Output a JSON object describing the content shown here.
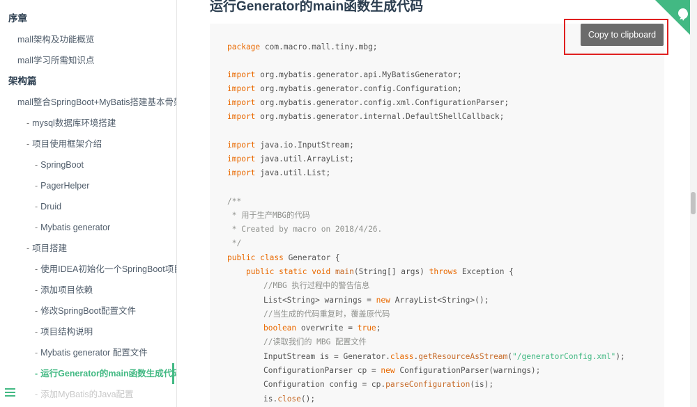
{
  "sidebar": {
    "items": [
      {
        "label": "序章",
        "level": "section"
      },
      {
        "label": "mall架构及功能概览",
        "level": "l1"
      },
      {
        "label": "mall学习所需知识点",
        "level": "l1"
      },
      {
        "label": "架构篇",
        "level": "section"
      },
      {
        "label": "mall整合SpringBoot+MyBatis搭建基本骨架",
        "level": "l1"
      },
      {
        "label": "mysql数据库环境搭建",
        "level": "l2"
      },
      {
        "label": "项目使用框架介绍",
        "level": "l2"
      },
      {
        "label": "SpringBoot",
        "level": "l3"
      },
      {
        "label": "PagerHelper",
        "level": "l3"
      },
      {
        "label": "Druid",
        "level": "l3"
      },
      {
        "label": "Mybatis generator",
        "level": "l3"
      },
      {
        "label": "项目搭建",
        "level": "l2"
      },
      {
        "label": "使用IDEA初始化一个SpringBoot项目",
        "level": "l3"
      },
      {
        "label": "添加项目依赖",
        "level": "l3"
      },
      {
        "label": "修改SpringBoot配置文件",
        "level": "l3"
      },
      {
        "label": "项目结构说明",
        "level": "l3"
      },
      {
        "label": "Mybatis generator 配置文件",
        "level": "l3"
      },
      {
        "label": "运行Generator的main函数生成代码",
        "level": "l3",
        "active": true
      },
      {
        "label": "添加MyBatis的Java配置",
        "level": "l3",
        "faded": true
      }
    ],
    "bullet": "-",
    "accent": "#42b983"
  },
  "main": {
    "heading": "运行Generator的main函数生成代码",
    "copy_button": "Copy to clipboard"
  },
  "code": {
    "l1": {
      "kw": "package",
      "rest": " com.macro.mall.tiny.mbg;"
    },
    "l2": {
      "kw": "import",
      "rest": " org.mybatis.generator.api.MyBatisGenerator;"
    },
    "l3": {
      "kw": "import",
      "rest": " org.mybatis.generator.config.Configuration;"
    },
    "l4": {
      "kw": "import",
      "rest": " org.mybatis.generator.config.xml.ConfigurationParser;"
    },
    "l5": {
      "kw": "import",
      "rest": " org.mybatis.generator.internal.DefaultShellCallback;"
    },
    "l6": {
      "kw": "import",
      "rest": " java.io.InputStream;"
    },
    "l7": {
      "kw": "import",
      "rest": " java.util.ArrayList;"
    },
    "l8": {
      "kw": "import",
      "rest": " java.util.List;"
    },
    "c1": "/**",
    "c2": " * 用于生产MBG的代码",
    "c3": " * Created by macro on 2018/4/26.",
    "c4": " */",
    "cls": {
      "kw": "public class",
      "name": " Generator {"
    },
    "main": {
      "indent": "    ",
      "kw": "public static void",
      "fn": " main",
      "args": "(String[] args) ",
      "kw2": "throws",
      "rest": " Exception {"
    },
    "m1": "//MBG 执行过程中的警告信息",
    "m2": {
      "a": "List<String> warnings = ",
      "kw": "new",
      "b": " ArrayList<String>();"
    },
    "m3": "//当生成的代码重复时，覆盖原代码",
    "m4": {
      "kw": "boolean",
      "a": " overwrite = ",
      "kw2": "true",
      "b": ";"
    },
    "m5": "//读取我们的 MBG 配置文件",
    "m6": {
      "a": "InputStream is = Generator.",
      "kw": "class",
      "b": ".",
      "fn": "getResourceAsStream",
      "c": "(",
      "str": "\"/generatorConfig.xml\"",
      "d": ");"
    },
    "m7": {
      "a": "ConfigurationParser cp = ",
      "kw": "new",
      "b": " ConfigurationParser(warnings);"
    },
    "m8": {
      "a": "Configuration config = cp.",
      "fn": "parseConfiguration",
      "b": "(is);"
    },
    "m9": {
      "a": "is.",
      "fn": "close",
      "b": "();"
    }
  }
}
